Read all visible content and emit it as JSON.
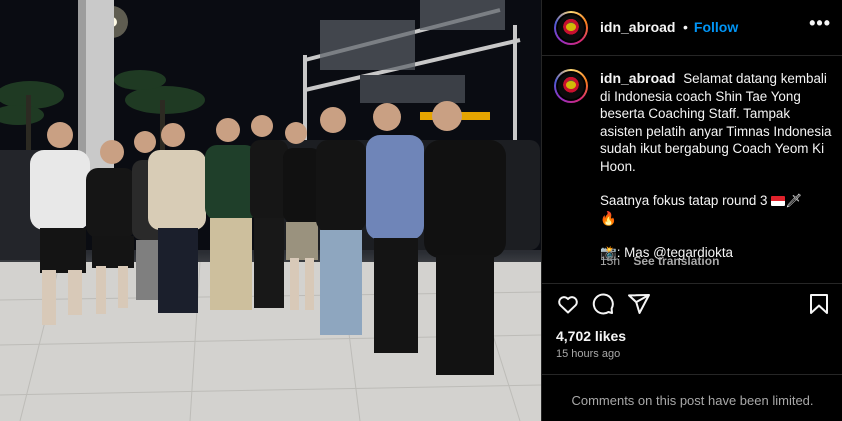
{
  "post": {
    "username": "idn_abroad",
    "dot": "•",
    "follow_label": "Follow",
    "more_label": "•••",
    "caption": {
      "line1": "Selamat datang kembali di Indonesia coach Shin Tae Yong beserta Coaching Staff. Tampak asisten pelatih anyar Timnas Indonesia sudah ikut bergabung Coach Yeom Ki Hoon.",
      "line2_text": "Saatnya fokus tatap round 3",
      "line2_emoji_after": "🗡",
      "line2_fire": "🔥",
      "credit_emoji": "📸",
      "credit": ": Mas @tegardiokta"
    },
    "timestamp_short": "15h",
    "see_translation": "See translation",
    "likes": "4,702 likes",
    "posted_ago": "15 hours ago",
    "comments_limited": "Comments on this post have been limited."
  },
  "icons": {
    "like": "heart-icon",
    "comment": "comment-icon",
    "share": "share-icon",
    "save": "bookmark-icon",
    "more": "more-icon"
  },
  "colors": {
    "background": "#000000",
    "text": "#f5f5f5",
    "muted": "#a8a8a8",
    "link": "#0095f6",
    "divider": "#262626"
  }
}
